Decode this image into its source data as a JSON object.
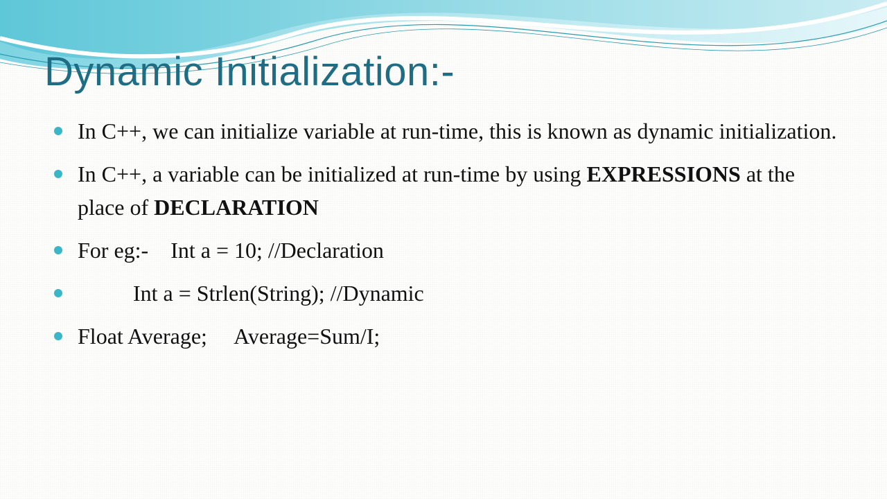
{
  "title": "Dynamic Initialization:-",
  "bullets": {
    "b1_pre": "In C++, we can initialize variable at run-time, this is known as dynamic initialization.",
    "b2_pre": "In C++, a variable can be initialized at run-time by using ",
    "b2_bold1": "EXPRESSIONS",
    "b2_mid": " at the place of ",
    "b2_bold2": "DECLARATION",
    "b3": "For eg:-    Int a = 10; //Declaration",
    "b4": "Int a = Strlen(String); //Dynamic",
    "b5": "Float Average;     Average=Sum/I;"
  }
}
